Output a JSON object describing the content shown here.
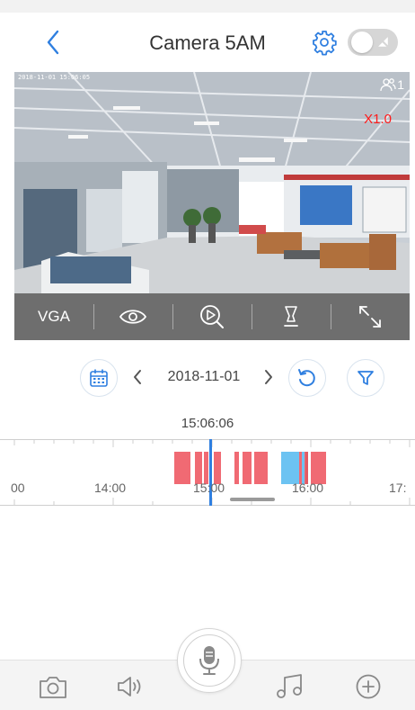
{
  "header": {
    "title": "Camera 5AM",
    "back_icon": "chevron-left-icon",
    "settings_icon": "gear-icon",
    "toggle_icon": "alarm-off-icon",
    "toggle_state": "off"
  },
  "video": {
    "osd_timestamp": "2018-11-01 15:06:05",
    "viewer_count": "1",
    "zoom_level": "X1.0"
  },
  "controls": {
    "quality_label": "VGA",
    "items": [
      "eye-icon",
      "search-play-icon",
      "snapshot-icon",
      "fullscreen-icon"
    ]
  },
  "date_bar": {
    "date": "2018-11-01",
    "calendar_icon": "calendar-icon",
    "refresh_icon": "refresh-icon",
    "filter_icon": "filter-icon"
  },
  "timeline": {
    "current_time": "15:06:06",
    "labels": [
      "00",
      "14:00",
      "15:00",
      "16:00",
      "17:"
    ]
  },
  "bottom_bar": {
    "items": [
      "camera-icon",
      "speaker-icon",
      "microphone-icon",
      "music-icon",
      "add-icon"
    ]
  },
  "colors": {
    "accent": "#2f7fe0",
    "alarm_segment": "#f06a73",
    "motion_segment": "#6cc3f2",
    "control_bar": "#6e6e6e",
    "zoom_text": "#ff1a1a"
  }
}
